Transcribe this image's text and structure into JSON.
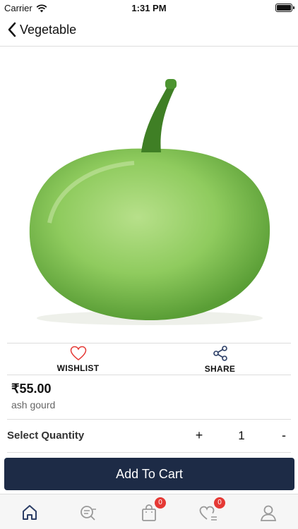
{
  "status_bar": {
    "carrier": "Carrier",
    "time": "1:31 PM"
  },
  "nav": {
    "title": "Vegetable"
  },
  "actions": {
    "wishlist_label": "WISHLIST",
    "share_label": "SHARE"
  },
  "product": {
    "price": "₹55.00",
    "name": "ash gourd"
  },
  "quantity": {
    "label": "Select Quantity",
    "plus": "+",
    "value": "1",
    "minus": "-"
  },
  "cart_button": {
    "label": "Add To Cart"
  },
  "tab_bar": {
    "cart_badge": "0",
    "wishlist_badge": "0"
  },
  "colors": {
    "primary": "#1d2b46",
    "accent_red": "#e53935",
    "icon_blue": "#2c3e66"
  },
  "icons": [
    "back-chevron-icon",
    "heart-icon",
    "share-icon",
    "home-icon",
    "search-icon",
    "bag-icon",
    "heart-list-icon",
    "user-icon"
  ]
}
